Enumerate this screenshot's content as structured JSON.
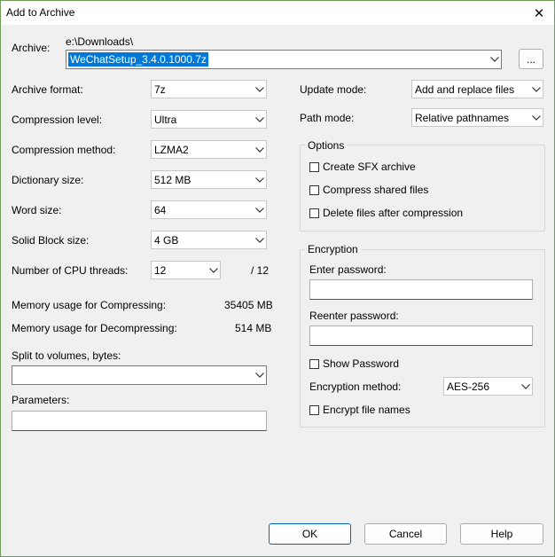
{
  "window": {
    "title": "Add to Archive"
  },
  "archive": {
    "label": "Archive:",
    "path": "e:\\Downloads\\",
    "name": "WeChatSetup_3.4.0.1000.7z",
    "browse_label": "..."
  },
  "left": {
    "format": {
      "label": "Archive format:",
      "value": "7z"
    },
    "level": {
      "label": "Compression level:",
      "value": "Ultra"
    },
    "method": {
      "label": "Compression method:",
      "value": "LZMA2"
    },
    "dictionary": {
      "label": "Dictionary size:",
      "value": "512 MB"
    },
    "word": {
      "label": "Word size:",
      "value": "64"
    },
    "solid": {
      "label": "Solid Block size:",
      "value": "4 GB"
    },
    "threads": {
      "label": "Number of CPU threads:",
      "value": "12",
      "max": "/ 12"
    },
    "mem_comp": {
      "label": "Memory usage for Compressing:",
      "value": "35405 MB"
    },
    "mem_decomp": {
      "label": "Memory usage for Decompressing:",
      "value": "514 MB"
    },
    "split": {
      "label": "Split to volumes, bytes:",
      "value": ""
    },
    "params": {
      "label": "Parameters:",
      "value": ""
    }
  },
  "right": {
    "update": {
      "label": "Update mode:",
      "value": "Add and replace files"
    },
    "path": {
      "label": "Path mode:",
      "value": "Relative pathnames"
    },
    "options": {
      "title": "Options",
      "sfx": "Create SFX archive",
      "shared": "Compress shared files",
      "delete": "Delete files after compression"
    },
    "encryption": {
      "title": "Encryption",
      "enter_label": "Enter password:",
      "reenter_label": "Reenter password:",
      "show_label": "Show Password",
      "method_label": "Encryption method:",
      "method_value": "AES-256",
      "names_label": "Encrypt file names"
    }
  },
  "buttons": {
    "ok": "OK",
    "cancel": "Cancel",
    "help": "Help"
  }
}
